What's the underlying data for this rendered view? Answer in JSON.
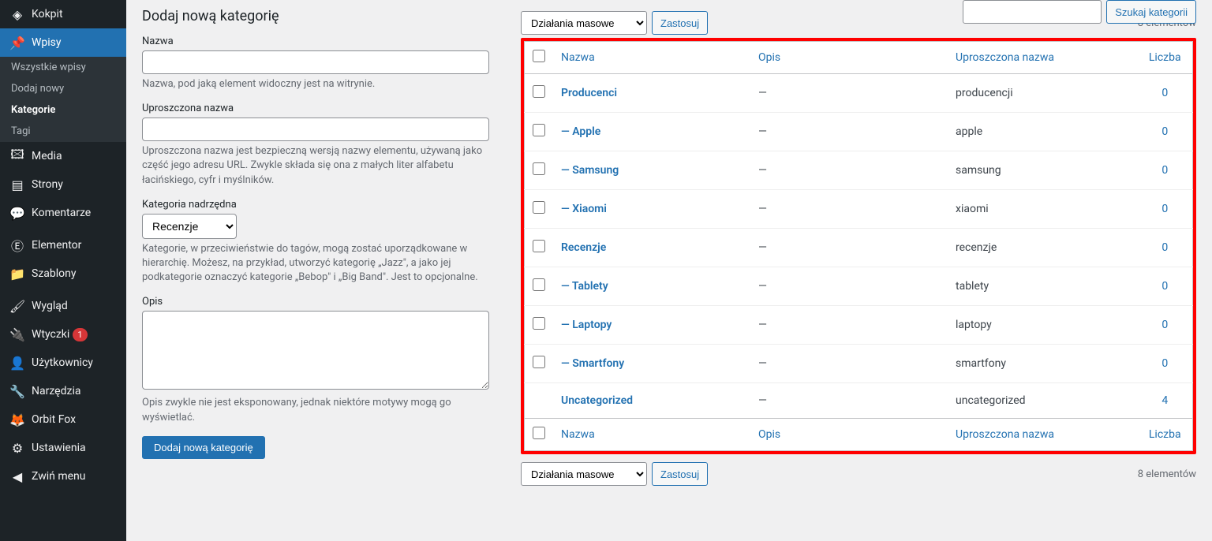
{
  "sidebar": {
    "items": [
      {
        "icon": "◈",
        "label": "Kokpit",
        "current": false,
        "name": "dashboard"
      },
      {
        "icon": "📌",
        "label": "Wpisy",
        "current": true,
        "name": "posts",
        "submenu": [
          {
            "label": "Wszystkie wpisy",
            "current": false,
            "name": "all-posts"
          },
          {
            "label": "Dodaj nowy",
            "current": false,
            "name": "add-new"
          },
          {
            "label": "Kategorie",
            "current": true,
            "name": "categories"
          },
          {
            "label": "Tagi",
            "current": false,
            "name": "tags"
          }
        ]
      },
      {
        "icon": "🖾",
        "label": "Media",
        "name": "media"
      },
      {
        "icon": "▤",
        "label": "Strony",
        "name": "pages"
      },
      {
        "icon": "💬",
        "label": "Komentarze",
        "name": "comments"
      },
      {
        "sep": true
      },
      {
        "icon": "Ⓔ",
        "label": "Elementor",
        "name": "elementor"
      },
      {
        "icon": "📁",
        "label": "Szablony",
        "name": "templates"
      },
      {
        "sep": true
      },
      {
        "icon": "🖌",
        "label": "Wygląd",
        "name": "appearance"
      },
      {
        "icon": "🔌",
        "label": "Wtyczki",
        "name": "plugins",
        "badge": "1"
      },
      {
        "icon": "👤",
        "label": "Użytkownicy",
        "name": "users"
      },
      {
        "icon": "🔧",
        "label": "Narzędzia",
        "name": "tools"
      },
      {
        "icon": "🦊",
        "label": "Orbit Fox",
        "name": "orbit-fox"
      },
      {
        "icon": "⚙",
        "label": "Ustawienia",
        "name": "settings"
      },
      {
        "icon": "◀",
        "label": "Zwiń menu",
        "name": "collapse"
      }
    ]
  },
  "search": {
    "button": "Szukaj kategorii"
  },
  "bulk": {
    "label": "Działania masowe",
    "apply": "Zastosuj"
  },
  "count_text": "8 elementów",
  "form": {
    "title": "Dodaj nową kategorię",
    "name_label": "Nazwa",
    "name_desc": "Nazwa, pod jaką element widoczny jest na witrynie.",
    "slug_label": "Uproszczona nazwa",
    "slug_desc": "Uproszczona nazwa jest bezpieczną wersją nazwy elementu, używaną jako część jego adresu URL. Zwykle składa się ona z małych liter alfabetu łacińskiego, cyfr i myślników.",
    "parent_label": "Kategoria nadrzędna",
    "parent_value": "Recenzje",
    "parent_desc": "Kategorie, w przeciwieństwie do tagów, mogą zostać uporządkowane w hierarchię. Możesz, na przykład, utworzyć kategorię „Jazz\", a jako jej podkategorie oznaczyć kategorie „Bebop\" i „Big Band\". Jest to opcjonalne.",
    "desc_label": "Opis",
    "desc_desc": "Opis zwykle nie jest eksponowany, jednak niektóre motywy mogą go wyświetlać.",
    "submit": "Dodaj nową kategorię"
  },
  "table": {
    "headers": {
      "name": "Nazwa",
      "desc": "Opis",
      "slug": "Uproszczona nazwa",
      "count": "Liczba"
    },
    "rows": [
      {
        "name": "Producenci",
        "desc": "—",
        "slug": "producencji",
        "count": "0",
        "cb": true
      },
      {
        "name": "— Apple",
        "desc": "—",
        "slug": "apple",
        "count": "0",
        "cb": true
      },
      {
        "name": "— Samsung",
        "desc": "—",
        "slug": "samsung",
        "count": "0",
        "cb": true
      },
      {
        "name": "— Xiaomi",
        "desc": "—",
        "slug": "xiaomi",
        "count": "0",
        "cb": true
      },
      {
        "name": "Recenzje",
        "desc": "—",
        "slug": "recenzje",
        "count": "0",
        "cb": true
      },
      {
        "name": "— Tablety",
        "desc": "—",
        "slug": "tablety",
        "count": "0",
        "cb": true
      },
      {
        "name": "— Laptopy",
        "desc": "—",
        "slug": "laptopy",
        "count": "0",
        "cb": true
      },
      {
        "name": "— Smartfony",
        "desc": "—",
        "slug": "smartfony",
        "count": "0",
        "cb": true
      },
      {
        "name": "Uncategorized",
        "desc": "—",
        "slug": "uncategorized",
        "count": "4",
        "cb": false
      }
    ]
  }
}
